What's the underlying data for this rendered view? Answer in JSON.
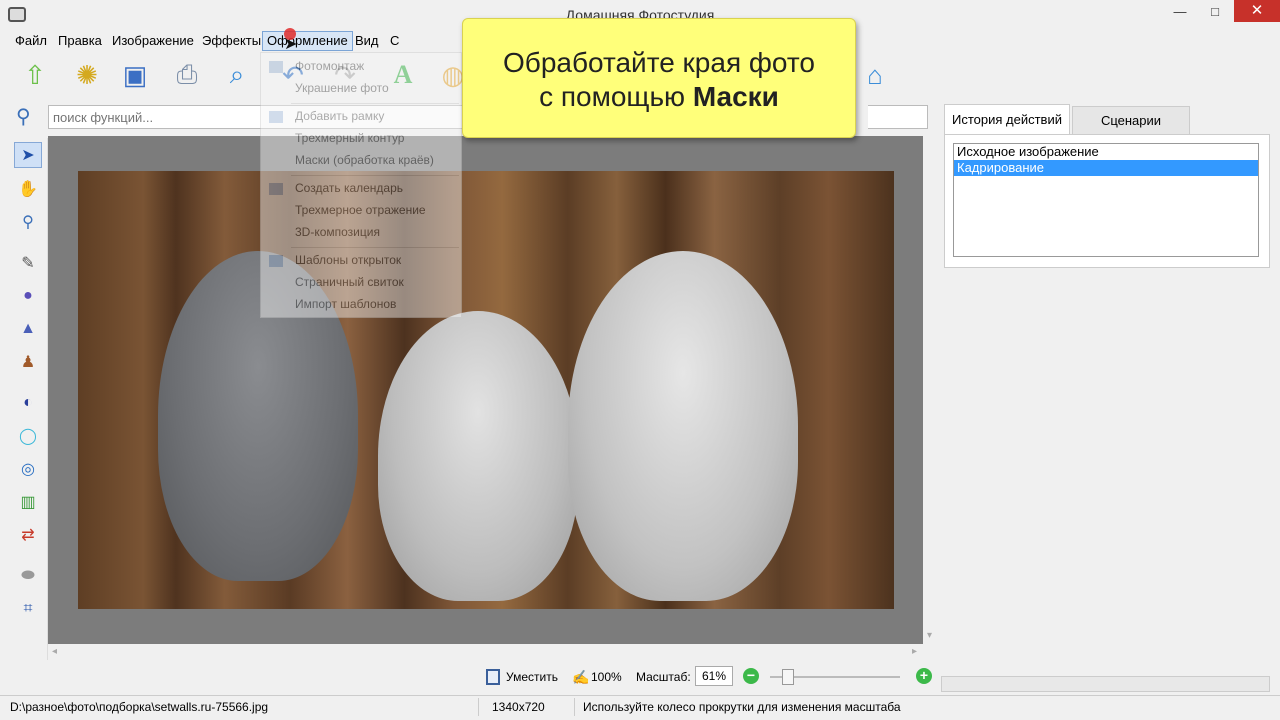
{
  "window": {
    "title": "Домашняя Фотостудия",
    "minimize": "—",
    "maximize": "□",
    "close": "✕"
  },
  "menu": {
    "items": [
      "Файл",
      "Правка",
      "Изображение",
      "Эффекты",
      "Оформление",
      "Вид",
      "С"
    ]
  },
  "toolbar": {
    "icons": [
      "open-folder-icon",
      "gear-film-icon",
      "save-icon",
      "print-icon",
      "zoom-preview-icon",
      "undo-icon",
      "redo-icon",
      "text-icon",
      "palette-icon",
      "home-icon"
    ]
  },
  "search": {
    "placeholder": "поиск функций..."
  },
  "dropdown": {
    "items": [
      "Фотомонтаж",
      "Украшение фото",
      "Добавить рамку",
      "Трехмерный контур",
      "Маски (обработка краёв)",
      "Создать календарь",
      "Трехмерное отражение",
      "3D-композиция",
      "Шаблоны открыток",
      "Страничный свиток",
      "Импорт шаблонов"
    ]
  },
  "callout": {
    "line1": "Обработайте края фото",
    "line2_prefix": "с помощью",
    "line2_bold": "Маски"
  },
  "panel": {
    "tabs": [
      "История действий",
      "Сценарии"
    ],
    "history": [
      "Исходное изображение",
      "Кадрирование"
    ],
    "selected_index": 1
  },
  "zoom": {
    "fit_label": "Уместить",
    "hundred_label": "100%",
    "scale_label": "Масштаб:",
    "scale_value": "61%",
    "minus": "−",
    "plus": "+"
  },
  "status": {
    "path": "D:\\разное\\фото\\подборка\\setwalls.ru-75566.jpg",
    "dimensions": "1340x720",
    "hint": "Используйте колесо прокрутки для изменения масштаба"
  },
  "colors": {
    "selection": "#3399ff",
    "callout": "#ffff7a",
    "close": "#c7312a"
  }
}
